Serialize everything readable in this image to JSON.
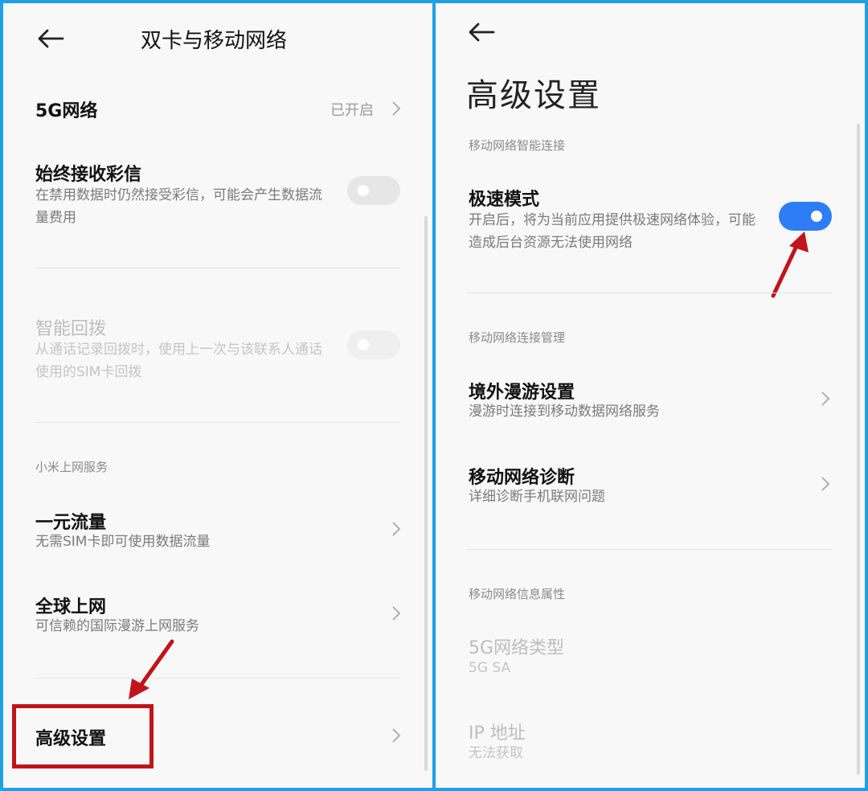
{
  "left": {
    "header": {
      "title": "双卡与移动网络"
    },
    "network_5g": {
      "title": "5G网络",
      "value": "已开启"
    },
    "mms": {
      "title": "始终接收彩信",
      "subtitle": "在禁用数据时仍然接受彩信，可能会产生数据流量费用",
      "enabled": false
    },
    "smart_redial": {
      "title": "智能回拨",
      "subtitle": "从通话记录回拨时，使用上一次与该联系人通话使用的SIM卡回拨",
      "enabled": false,
      "disabled": true
    },
    "section_xiaomi": "小米上网服务",
    "one_yuan": {
      "title": "一元流量",
      "subtitle": "无需SIM卡即可使用数据流量"
    },
    "global_net": {
      "title": "全球上网",
      "subtitle": "可信赖的国际漫游上网服务"
    },
    "advanced": {
      "title": "高级设置"
    }
  },
  "right": {
    "header": {
      "title": "高级设置"
    },
    "section_smart": "移动网络智能连接",
    "turbo": {
      "title": "极速模式",
      "subtitle": "开启后，将为当前应用提供极速网络体验，可能造成后台资源无法使用网络",
      "enabled": true
    },
    "section_manage": "移动网络连接管理",
    "roaming": {
      "title": "境外漫游设置",
      "subtitle": "漫游时连接到移动数据网络服务"
    },
    "diagnosis": {
      "title": "移动网络诊断",
      "subtitle": "详细诊断手机联网问题"
    },
    "section_info": "移动网络信息属性",
    "network_type": {
      "title": "5G网络类型",
      "value": "5G SA"
    },
    "ip": {
      "title": "IP 地址",
      "value": "无法获取"
    }
  },
  "colors": {
    "frame": "#1da1e6",
    "toggle_on": "#2f7df6",
    "annotation": "#c0141a"
  }
}
